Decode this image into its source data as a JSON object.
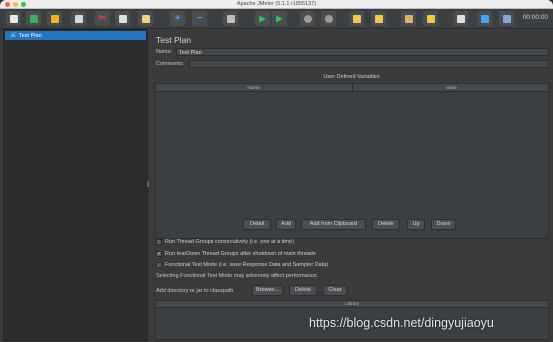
{
  "window": {
    "title": "Apache JMeter (5.1.1 r1855137)"
  },
  "toolbar": {
    "timer": "00:00:00",
    "icons": [
      {
        "name": "new-icon",
        "color": "#e8e8e8"
      },
      {
        "name": "templates-icon",
        "color": "#41a85f"
      },
      {
        "name": "open-icon",
        "color": "#f0b429"
      },
      {
        "name": "save-icon",
        "color": "#d9d9d9"
      },
      {
        "name": "cut-icon",
        "color": "#d64541"
      },
      {
        "name": "copy-icon",
        "color": "#e0e0e0"
      },
      {
        "name": "paste-icon",
        "color": "#f2d17b"
      },
      {
        "name": "expand-icon",
        "color": "#4aa3f0"
      },
      {
        "name": "collapse-icon",
        "color": "#4aa3f0"
      },
      {
        "name": "toggle-icon",
        "color": "#bdbdbd"
      },
      {
        "name": "start-icon",
        "color": "#35c35a"
      },
      {
        "name": "start-no-pauses-icon",
        "color": "#35c35a"
      },
      {
        "name": "stop-icon",
        "color": "#9a9a9a"
      },
      {
        "name": "shutdown-icon",
        "color": "#9a9a9a"
      },
      {
        "name": "clear-icon",
        "color": "#f2c94c"
      },
      {
        "name": "clear-all-icon",
        "color": "#f2c94c"
      },
      {
        "name": "search-icon",
        "color": "#d9b36c"
      },
      {
        "name": "reset-search-icon",
        "color": "#f2c94c"
      },
      {
        "name": "function-helper-icon",
        "color": "#e0e0e0"
      },
      {
        "name": "help-icon",
        "color": "#4aa3f0"
      },
      {
        "name": "remote-icon",
        "color": "#7fa8d6"
      }
    ]
  },
  "tree": {
    "items": [
      {
        "label": "Test Plan",
        "icon": "test-plan-icon"
      }
    ]
  },
  "main": {
    "title": "Test Plan",
    "name_label": "Name:",
    "name_value": "Test Plan",
    "comments_label": "Comments:",
    "udv": {
      "title": "User Defined Variables",
      "columns": [
        "Name:",
        "Value"
      ]
    },
    "buttons": [
      "Detail",
      "Add",
      "Add from Clipboard",
      "Delete",
      "Up",
      "Down"
    ],
    "options": [
      {
        "label": "Run Thread Groups consecutively (i.e. one at a time)",
        "checked": false
      },
      {
        "label": "Run tearDown Thread Groups after shutdown of main threads",
        "checked": true
      },
      {
        "label": "Functional Test Mode (i.e. save Response Data and Sampler Data)",
        "checked": false
      }
    ],
    "functional_note": "Selecting Functional Test Mode may adversely affect performance.",
    "classpath_label": "Add directory or jar to classpath",
    "classpath_buttons": [
      "Browse...",
      "Delete",
      "Clear"
    ],
    "library_column": "Library"
  },
  "watermark": "https://blog.csdn.net/dingyujiaoyu"
}
